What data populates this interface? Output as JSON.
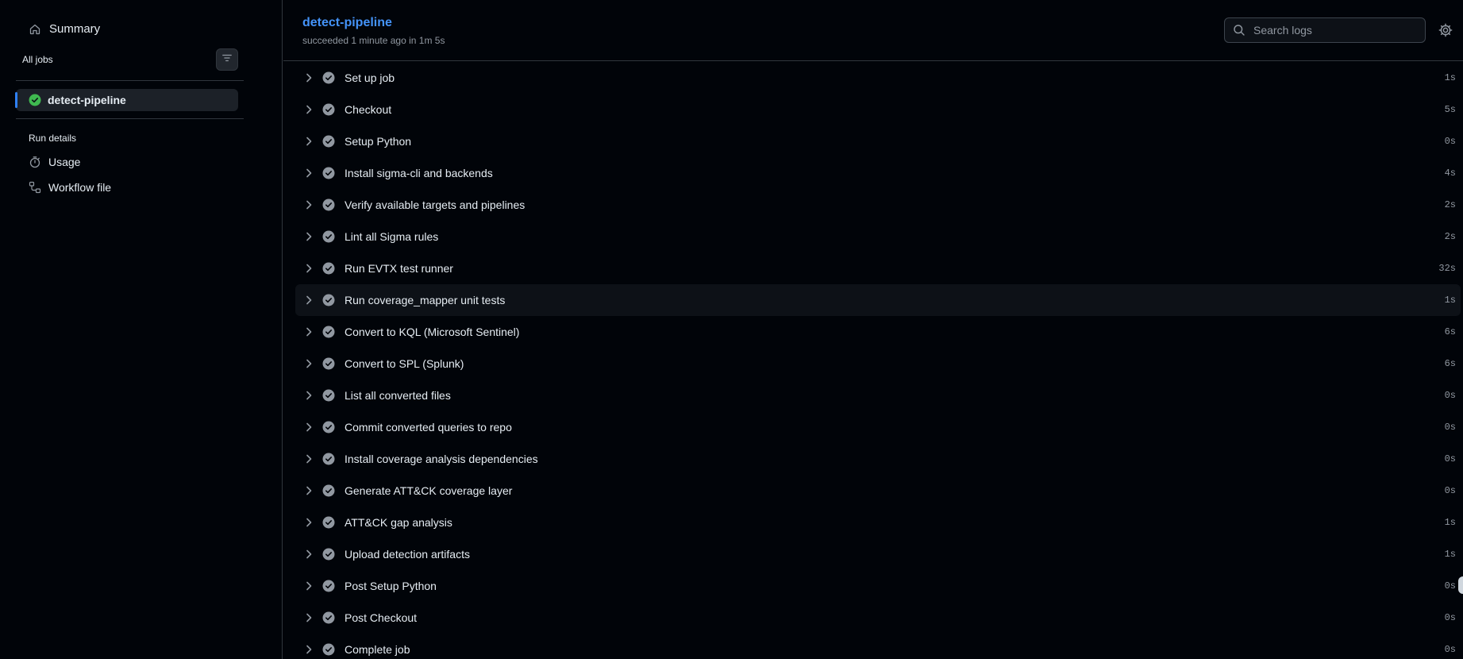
{
  "sidebar": {
    "summary_label": "Summary",
    "all_jobs_label": "All jobs",
    "jobs": [
      {
        "label": "detect-pipeline",
        "status": "success"
      }
    ],
    "run_details_label": "Run details",
    "usage_label": "Usage",
    "workflow_file_label": "Workflow file"
  },
  "header": {
    "title": "detect-pipeline",
    "subtitle": "succeeded 1 minute ago in 1m 5s",
    "search_placeholder": "Search logs"
  },
  "steps": [
    {
      "name": "Set up job",
      "duration": "1s"
    },
    {
      "name": "Checkout",
      "duration": "5s"
    },
    {
      "name": "Setup Python",
      "duration": "0s"
    },
    {
      "name": "Install sigma-cli and backends",
      "duration": "4s"
    },
    {
      "name": "Verify available targets and pipelines",
      "duration": "2s"
    },
    {
      "name": "Lint all Sigma rules",
      "duration": "2s"
    },
    {
      "name": "Run EVTX test runner",
      "duration": "32s"
    },
    {
      "name": "Run coverage_mapper unit tests",
      "duration": "1s"
    },
    {
      "name": "Convert to KQL (Microsoft Sentinel)",
      "duration": "6s"
    },
    {
      "name": "Convert to SPL (Splunk)",
      "duration": "6s"
    },
    {
      "name": "List all converted files",
      "duration": "0s"
    },
    {
      "name": "Commit converted queries to repo",
      "duration": "0s"
    },
    {
      "name": "Install coverage analysis dependencies",
      "duration": "0s"
    },
    {
      "name": "Generate ATT&CK coverage layer",
      "duration": "0s"
    },
    {
      "name": "ATT&CK gap analysis",
      "duration": "1s"
    },
    {
      "name": "Upload detection artifacts",
      "duration": "1s"
    },
    {
      "name": "Post Setup Python",
      "duration": "0s"
    },
    {
      "name": "Post Checkout",
      "duration": "0s"
    },
    {
      "name": "Complete job",
      "duration": "0s"
    }
  ],
  "colors": {
    "background": "#010409",
    "accent_link": "#4493f8",
    "success": "#3fb950",
    "step_check": "#9198a1",
    "selected_bar": "#2f81f7"
  },
  "icons": {
    "summary": "home-icon",
    "filter": "filter-icon",
    "job_status": "check-circle-fill-icon",
    "usage": "stopwatch-icon",
    "workflow": "workflow-icon",
    "search": "search-icon",
    "settings": "gear-icon",
    "step_expand": "chevron-right-icon",
    "step_status": "check-circle-fill-icon"
  }
}
